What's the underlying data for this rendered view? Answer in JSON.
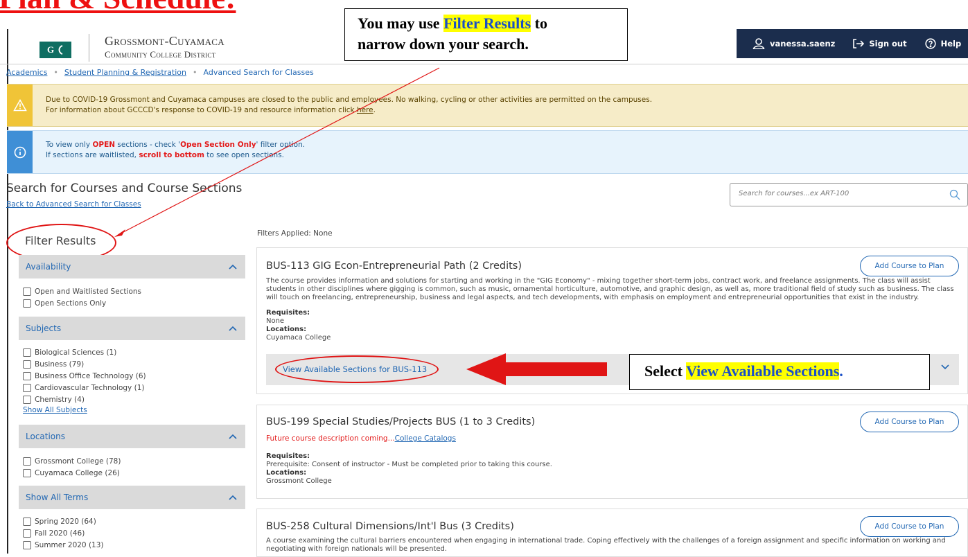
{
  "doc_title": "Plan & Schedule:",
  "header": {
    "logo_text": "G",
    "college_line1": "Grossmont-Cuyamaca",
    "college_line2": "Community College District",
    "username": "vanessa.saenz",
    "sign_out": "Sign out",
    "help": "Help"
  },
  "callout_top": {
    "before": "You may use ",
    "highlight": "Filter Results",
    "after": " to",
    "line2": "narrow down your search."
  },
  "breadcrumb": {
    "item1": "Academics",
    "item2": "Student Planning & Registration",
    "item3": "Advanced Search for Classes"
  },
  "alert_warning": {
    "line1": "Due to COVID-19 Grossmont and Cuyamaca campuses are closed to the public and employees. No walking, cycling or other activities are permitted on the campuses.",
    "line2_before": "For information about GCCCD's response to COVID-19 and resource information click ",
    "line2_link": "here",
    "line2_after": "."
  },
  "alert_info": {
    "l1_a": "To view only ",
    "l1_b": "OPEN",
    "l1_c": " sections - check '",
    "l1_d": "Open Section Only",
    "l1_e": "' filter option.",
    "l2_a": "If sections are waitlisted, ",
    "l2_b": "scroll to bottom",
    "l2_c": " to see open sections."
  },
  "page": {
    "title": "Search for Courses and Course Sections",
    "back_link": "Back to Advanced Search for Classes",
    "search_placeholder": "Search for courses...ex ART-100"
  },
  "sidebar": {
    "title": "Filter Results",
    "availability": {
      "header": "Availability",
      "items": [
        "Open and Waitlisted Sections",
        "Open Sections Only"
      ]
    },
    "subjects": {
      "header": "Subjects",
      "items": [
        "Biological Sciences (1)",
        "Business (79)",
        "Business Office Technology (6)",
        "Cardiovascular Technology (1)",
        "Chemistry (4)"
      ],
      "show_all": "Show All Subjects"
    },
    "locations": {
      "header": "Locations",
      "items": [
        "Grossmont College (78)",
        "Cuyamaca College (26)"
      ]
    },
    "terms": {
      "header": "Show All Terms",
      "items": [
        "Spring 2020 (64)",
        "Fall 2020 (46)",
        "Summer 2020 (13)"
      ]
    }
  },
  "results": {
    "filters_applied": "Filters Applied: None",
    "add_label": "Add Course to Plan",
    "requisites_label": "Requisites:",
    "locations_label": "Locations:",
    "courses": [
      {
        "title": "BUS-113 GIG Econ-Entrepreneurial Path (2 Credits)",
        "desc1": "The course provides information and solutions for starting and working in the \"GIG Economy\" - mixing together short-term jobs, contract work, and freelance assignments. The class will assist",
        "desc2": "students in other disciplines where gigging is common, such as music, ornamental horticulture, automotive, and graphic design, as well as, more traditional field of study such as business. The class",
        "desc3": "will touch on freelancing, entrepreneurship, business and legal aspects, and tech developments, with emphasis on employment and entrepreneurial opportunities that exist in the industry.",
        "requisites": "None",
        "location": "Cuyamaca College",
        "sections_link": "View Available Sections for BUS-113"
      },
      {
        "title": "BUS-199 Special Studies/Projects BUS (1 to 3 Credits)",
        "future_text": "Future course description coming...",
        "catalog_link": "College Catalogs",
        "requisites": "Prerequisite: Consent of instructor - Must be completed prior to taking this course.",
        "location": "Grossmont College"
      },
      {
        "title": "BUS-258 Cultural Dimensions/Int'l Bus (3 Credits)",
        "desc1": "A course examining the cultural barriers encountered when engaging in international trade. Coping effectively with the challenges of a foreign assignment and specific information on working and",
        "desc2": "negotiating with foreign nationals will be presented."
      }
    ]
  },
  "callout_right": {
    "before": "Select ",
    "highlight": "View Available Sections",
    "after": "."
  },
  "colors": {
    "annotation_red": "#e01515",
    "link_blue": "#2167b3",
    "userbar_navy": "#1b2d4d",
    "warning_yellow": "#f0c437",
    "info_blue": "#3f8fd6"
  }
}
